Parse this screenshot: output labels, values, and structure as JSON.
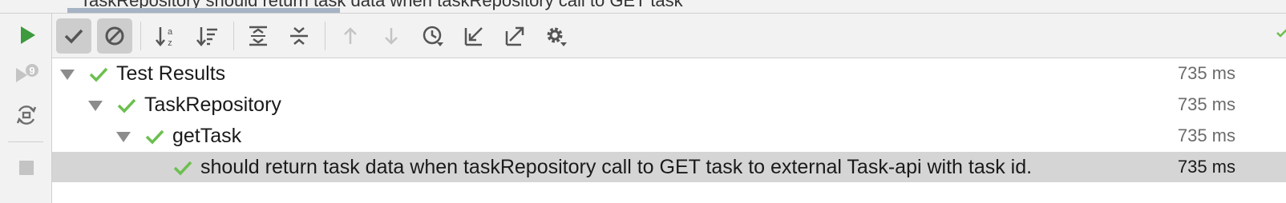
{
  "window": {
    "top_tab_text": "TaskRepository     should return task data when taskRepository call to GET task"
  },
  "left_gutter": {
    "icons": [
      "run-icon",
      "rerun-failed-icon",
      "toggle-auto-test-icon",
      "stop-icon"
    ]
  },
  "toolbar": {
    "buttons": [
      {
        "name": "show-passed",
        "toggled": true
      },
      {
        "name": "show-ignored",
        "toggled": true
      },
      {
        "name": "sort-alphabetically",
        "toggled": false
      },
      {
        "name": "sort-by-duration",
        "toggled": false
      },
      {
        "name": "expand-all",
        "toggled": false
      },
      {
        "name": "collapse-all",
        "toggled": false
      },
      {
        "name": "previous-failed-test",
        "enabled": false
      },
      {
        "name": "next-failed-test",
        "enabled": false
      },
      {
        "name": "test-history",
        "toggled": false
      },
      {
        "name": "import-tests",
        "toggled": false
      },
      {
        "name": "export-tests",
        "toggled": false
      },
      {
        "name": "settings",
        "toggled": false
      }
    ]
  },
  "tree": {
    "rows": [
      {
        "label": "Test Results",
        "time": "735 ms",
        "status": "passed",
        "expanded": true,
        "selected": false
      },
      {
        "label": "TaskRepository",
        "time": "735 ms",
        "status": "passed",
        "expanded": true,
        "selected": false
      },
      {
        "label": "getTask",
        "time": "735 ms",
        "status": "passed",
        "expanded": true,
        "selected": false
      },
      {
        "label": "should return task data when taskRepository call to GET task to external Task-api with task id.",
        "time": "735 ms",
        "status": "passed",
        "expanded": false,
        "selected": true
      }
    ]
  },
  "colors": {
    "pass_green": "#6cbf4e",
    "run_green": "#3d9a3d",
    "selection": "#d5d5d5",
    "toolbar_toggled": "#cdcdcd"
  }
}
